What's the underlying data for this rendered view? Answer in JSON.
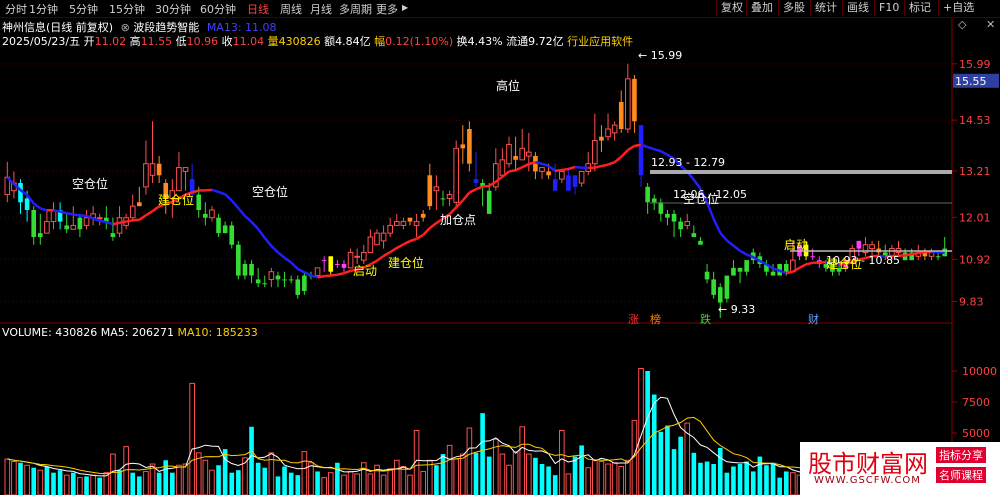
{
  "toolbar": {
    "timeframes": [
      "分时",
      "1分钟",
      "5分钟",
      "15分钟",
      "30分钟",
      "60分钟",
      "日线",
      "周线",
      "月线",
      "多周期",
      "更多"
    ],
    "active_index": 6,
    "more_arrow": "▶",
    "buttons": [
      "复权",
      "叠加",
      "多股",
      "统计",
      "画线",
      "F10",
      "标记",
      "+自选"
    ],
    "close_icon": "✕",
    "diamond_icon": "◇"
  },
  "header": {
    "stock": "神州信息(日线 前复权)",
    "indicator_icon": "⊗",
    "indicator": "波段趋势智能",
    "ma_label": "MA13: 11.08",
    "date": "2025/05/23/五",
    "open_label": "开",
    "open": "11.02",
    "high_label": "高",
    "high": "11.55",
    "low_label": "低",
    "low": "10.96",
    "close_label": "收",
    "close": "11.04",
    "vol_label": "量",
    "vol": "430826",
    "amt_label": "额",
    "amt": "4.84亿",
    "chg_label": "幅",
    "chg": "0.12(1.10%)",
    "turn_label": "换",
    "turn": "4.43%",
    "float_label": "流通",
    "float": "9.72亿",
    "industry": "行业应用软件"
  },
  "price_axis": {
    "ticks": [
      "15.99",
      "14.53",
      "13.21",
      "12.01",
      "10.92",
      "9.83"
    ],
    "current": "15.55"
  },
  "annotations": {
    "high_point": "15.99",
    "low_point": "9.33",
    "box1": "12.93 - 12.79",
    "box2": "12.06 - 12.05",
    "box3": "10.93 - 10.85",
    "labels": [
      "空仓位",
      "建仓位",
      "空仓位",
      "启动",
      "建仓位",
      "高位",
      "加仓点",
      "空仓位",
      "启动",
      "建仓位"
    ],
    "badges": [
      "涨",
      "榜",
      "跌",
      "财"
    ]
  },
  "volume": {
    "label": "VOLUME: 430826",
    "ma5": "MA5: 206271",
    "ma10": "MA10: 185233",
    "ticks": [
      "10000",
      "7500",
      "5000"
    ]
  },
  "watermark": {
    "main": "股市财富网",
    "url": "WWW.GSCFW.COM",
    "tag1": "指标分享",
    "tag2": "名师课程"
  },
  "colors": {
    "up": "#ff5050",
    "down": "#00ffff",
    "orange": "#ff8a1f",
    "green": "#33dd33",
    "ma_red": "#ff2020",
    "ma_blue": "#2020ff",
    "yellow": "#ffff00",
    "magenta": "#ff40ff"
  },
  "chart_data": {
    "type": "candlestick",
    "ylim": [
      9.4,
      16.4
    ],
    "candles": [
      [
        12.6,
        13.05,
        13.45,
        12.4,
        "up"
      ],
      [
        12.9,
        12.7,
        13.2,
        12.5,
        "up"
      ],
      [
        12.9,
        12.4,
        13.0,
        12.1,
        "down"
      ],
      [
        12.5,
        12.2,
        12.7,
        11.9,
        "down"
      ],
      [
        12.2,
        11.5,
        12.3,
        11.3,
        "green"
      ],
      [
        11.5,
        11.6,
        12.1,
        11.3,
        "green"
      ],
      [
        11.6,
        11.9,
        12.2,
        11.6,
        "up"
      ],
      [
        11.9,
        12.2,
        12.4,
        11.7,
        "up"
      ],
      [
        12.2,
        11.9,
        12.4,
        11.7,
        "down"
      ],
      [
        11.8,
        11.7,
        12.1,
        11.6,
        "green"
      ],
      [
        11.7,
        11.8,
        12.3,
        11.7,
        "up"
      ],
      [
        12.0,
        11.7,
        12.1,
        11.5,
        "green"
      ],
      [
        11.8,
        12.0,
        12.2,
        11.7,
        "up"
      ],
      [
        12.0,
        12.1,
        12.3,
        11.8,
        "up"
      ],
      [
        12.0,
        12.0,
        12.1,
        11.8,
        "up"
      ],
      [
        12.0,
        11.9,
        12.3,
        11.7,
        "green"
      ],
      [
        11.6,
        11.5,
        12.0,
        11.4,
        "green"
      ],
      [
        11.6,
        12.0,
        12.3,
        11.5,
        "up"
      ],
      [
        11.8,
        12.0,
        12.1,
        11.7,
        "up"
      ],
      [
        12.0,
        12.3,
        12.6,
        11.9,
        "up"
      ],
      [
        12.3,
        12.4,
        12.8,
        12.3,
        "orange"
      ],
      [
        12.8,
        13.4,
        14.0,
        12.6,
        "up"
      ],
      [
        13.4,
        13.1,
        14.5,
        12.9,
        "up"
      ],
      [
        13.1,
        13.4,
        13.6,
        12.9,
        "orange"
      ],
      [
        12.9,
        12.5,
        13.0,
        12.1,
        "orange"
      ],
      [
        12.5,
        12.7,
        13.0,
        12.0,
        "up"
      ],
      [
        12.7,
        13.3,
        13.7,
        12.7,
        "up"
      ],
      [
        13.2,
        13.3,
        13.3,
        12.7,
        "up"
      ],
      [
        13.0,
        12.6,
        13.4,
        12.4,
        "blue"
      ],
      [
        12.6,
        12.2,
        12.8,
        12.0,
        "green"
      ],
      [
        12.1,
        12.0,
        12.4,
        11.8,
        "green"
      ],
      [
        12.0,
        12.2,
        12.3,
        11.9,
        "up"
      ],
      [
        12.0,
        11.6,
        12.1,
        11.5,
        "green"
      ],
      [
        11.8,
        11.6,
        11.9,
        11.6,
        "green"
      ],
      [
        11.8,
        11.3,
        11.9,
        11.2,
        "green"
      ],
      [
        11.3,
        10.5,
        11.4,
        10.4,
        "green"
      ],
      [
        10.5,
        10.8,
        10.9,
        10.4,
        "green"
      ],
      [
        10.8,
        10.5,
        10.9,
        10.3,
        "green"
      ],
      [
        10.4,
        10.3,
        10.7,
        10.2,
        "green"
      ],
      [
        10.3,
        10.3,
        10.5,
        10.2,
        "green"
      ],
      [
        10.4,
        10.6,
        10.7,
        10.2,
        "up"
      ],
      [
        10.5,
        10.4,
        10.6,
        10.2,
        "green"
      ],
      [
        10.4,
        10.4,
        10.6,
        10.2,
        "green"
      ],
      [
        10.4,
        10.4,
        10.5,
        10.3,
        "green"
      ],
      [
        10.4,
        10.0,
        10.5,
        9.9,
        "green"
      ],
      [
        10.1,
        10.5,
        10.6,
        10.0,
        "green"
      ],
      [
        10.5,
        10.5,
        10.6,
        10.4,
        "green"
      ],
      [
        10.5,
        10.7,
        10.7,
        10.5,
        "up"
      ],
      [
        10.9,
        10.9,
        11.0,
        10.6,
        "magenta"
      ],
      [
        10.6,
        11.0,
        11.0,
        10.5,
        "yellow"
      ],
      [
        10.8,
        10.8,
        10.9,
        10.7,
        "magenta"
      ],
      [
        10.7,
        10.8,
        10.9,
        10.6,
        "magenta"
      ],
      [
        10.7,
        11.1,
        11.2,
        10.7,
        "up"
      ],
      [
        11.0,
        11.0,
        11.2,
        10.8,
        "up"
      ],
      [
        10.9,
        11.1,
        11.3,
        10.8,
        "up"
      ],
      [
        11.1,
        11.5,
        11.7,
        11.1,
        "up"
      ],
      [
        11.3,
        11.6,
        11.7,
        11.3,
        "up"
      ],
      [
        11.4,
        11.6,
        11.8,
        11.2,
        "up"
      ],
      [
        11.6,
        11.8,
        12.0,
        11.5,
        "up"
      ],
      [
        11.8,
        11.9,
        12.1,
        11.8,
        "up"
      ],
      [
        11.8,
        11.9,
        12.0,
        11.7,
        "up"
      ],
      [
        11.9,
        12.0,
        12.0,
        11.8,
        "orange"
      ],
      [
        11.9,
        11.8,
        12.1,
        11.5,
        "up"
      ],
      [
        12.0,
        12.1,
        12.2,
        11.9,
        "orange"
      ],
      [
        12.3,
        13.1,
        13.4,
        12.2,
        "orange"
      ],
      [
        12.7,
        12.8,
        13.1,
        12.2,
        "up"
      ],
      [
        12.5,
        12.5,
        12.7,
        12.3,
        "green"
      ],
      [
        12.5,
        12.6,
        12.7,
        12.3,
        "up"
      ],
      [
        12.4,
        13.8,
        14.0,
        12.3,
        "up"
      ],
      [
        13.8,
        13.9,
        14.4,
        13.4,
        "orange"
      ],
      [
        13.4,
        14.3,
        14.5,
        13.2,
        "orange"
      ],
      [
        13.0,
        12.9,
        13.7,
        12.8,
        "blue"
      ],
      [
        12.9,
        12.8,
        13.0,
        12.3,
        "green"
      ],
      [
        12.7,
        12.1,
        12.9,
        12.1,
        "green"
      ],
      [
        12.8,
        13.4,
        13.8,
        12.7,
        "up"
      ],
      [
        13.1,
        13.5,
        13.8,
        13.1,
        "up"
      ],
      [
        13.4,
        13.9,
        14.1,
        13.3,
        "up"
      ],
      [
        13.6,
        13.5,
        14.1,
        13.2,
        "orange"
      ],
      [
        13.5,
        13.8,
        14.3,
        13.5,
        "up"
      ],
      [
        13.7,
        13.6,
        14.2,
        13.2,
        "up"
      ],
      [
        13.6,
        13.2,
        13.7,
        13.0,
        "orange"
      ],
      [
        13.2,
        13.3,
        13.3,
        13.0,
        "up"
      ],
      [
        13.2,
        13.1,
        13.4,
        13.0,
        "orange"
      ],
      [
        13.0,
        12.7,
        13.4,
        12.7,
        "blue"
      ],
      [
        13.0,
        13.2,
        13.2,
        12.9,
        "up"
      ],
      [
        12.7,
        13.1,
        13.3,
        12.7,
        "blue"
      ],
      [
        13.1,
        12.8,
        13.1,
        12.6,
        "blue"
      ],
      [
        12.9,
        13.2,
        13.2,
        12.8,
        "up"
      ],
      [
        13.2,
        13.4,
        13.7,
        13.1,
        "up"
      ],
      [
        13.4,
        14.0,
        14.7,
        13.2,
        "up"
      ],
      [
        14.1,
        14.0,
        14.4,
        13.7,
        "orange"
      ],
      [
        14.1,
        14.3,
        14.7,
        14.0,
        "up"
      ],
      [
        14.2,
        14.4,
        14.5,
        14.0,
        "up"
      ],
      [
        14.3,
        15.0,
        15.3,
        14.2,
        "orange"
      ],
      [
        14.3,
        15.6,
        15.99,
        14.2,
        "up"
      ],
      [
        15.6,
        14.5,
        15.7,
        14.2,
        "orange"
      ],
      [
        14.4,
        13.1,
        14.4,
        12.8,
        "blue"
      ],
      [
        12.8,
        12.4,
        12.9,
        12.1,
        "green"
      ],
      [
        12.5,
        12.4,
        12.6,
        12.2,
        "green"
      ],
      [
        12.4,
        12.1,
        12.5,
        11.9,
        "green"
      ],
      [
        12.1,
        12.0,
        12.2,
        11.8,
        "green"
      ],
      [
        11.9,
        12.1,
        12.2,
        11.5,
        "green"
      ],
      [
        11.9,
        11.7,
        12.0,
        11.5,
        "green"
      ],
      [
        11.8,
        11.9,
        12.1,
        11.7,
        "up"
      ],
      [
        11.5,
        11.6,
        11.8,
        11.5,
        "green"
      ],
      [
        11.3,
        11.4,
        11.5,
        11.3,
        "green"
      ],
      [
        10.6,
        10.4,
        10.8,
        10.3,
        "green"
      ],
      [
        10.4,
        10.0,
        10.6,
        9.9,
        "green"
      ],
      [
        10.2,
        9.8,
        10.3,
        9.4,
        "green"
      ],
      [
        9.9,
        10.5,
        10.5,
        9.8,
        "green"
      ],
      [
        10.5,
        10.7,
        10.9,
        10.5,
        "green"
      ],
      [
        10.7,
        10.6,
        10.7,
        10.3,
        "green"
      ],
      [
        10.6,
        10.9,
        10.9,
        10.5,
        "green"
      ],
      [
        10.9,
        11.1,
        11.2,
        10.8,
        "green"
      ],
      [
        11.0,
        10.8,
        11.1,
        10.7,
        "green"
      ],
      [
        10.8,
        10.6,
        10.9,
        10.5,
        "green"
      ],
      [
        10.6,
        10.5,
        10.8,
        10.5,
        "green"
      ],
      [
        10.5,
        10.8,
        10.8,
        10.5,
        "green"
      ],
      [
        10.8,
        10.6,
        10.9,
        10.5,
        "green"
      ],
      [
        10.6,
        10.9,
        11.4,
        10.6,
        "up"
      ],
      [
        11.0,
        11.3,
        11.4,
        10.9,
        "magenta"
      ],
      [
        11.3,
        11.0,
        11.4,
        10.9,
        "yellow"
      ],
      [
        11.0,
        11.0,
        11.2,
        10.9,
        "magenta"
      ],
      [
        10.9,
        10.8,
        11.0,
        10.7,
        "magenta"
      ],
      [
        10.8,
        10.7,
        10.9,
        10.6,
        "green"
      ],
      [
        10.8,
        10.6,
        10.8,
        10.5,
        "green"
      ],
      [
        10.6,
        10.7,
        10.9,
        10.5,
        "green"
      ],
      [
        10.7,
        10.9,
        10.9,
        10.6,
        "magenta"
      ],
      [
        10.9,
        11.2,
        11.3,
        10.8,
        "up"
      ],
      [
        11.2,
        11.4,
        11.4,
        11.0,
        "magenta"
      ],
      [
        11.1,
        11.3,
        11.5,
        11.0,
        "up"
      ],
      [
        11.3,
        11.2,
        11.4,
        10.9,
        "up"
      ],
      [
        11.2,
        11.1,
        11.4,
        11.0,
        "orange"
      ],
      [
        11.1,
        11.0,
        11.3,
        10.9,
        "green"
      ],
      [
        11.0,
        11.2,
        11.3,
        10.9,
        "up"
      ],
      [
        11.2,
        11.1,
        11.4,
        11.0,
        "up"
      ],
      [
        11.1,
        10.9,
        11.2,
        10.9,
        "green"
      ],
      [
        10.9,
        11.1,
        11.2,
        10.9,
        "green"
      ],
      [
        11.1,
        11.0,
        11.3,
        10.9,
        "up"
      ],
      [
        11.0,
        11.1,
        11.2,
        10.9,
        "orange"
      ],
      [
        11.1,
        11.0,
        11.2,
        10.9,
        "up"
      ],
      [
        11.0,
        11.0,
        11.1,
        10.9,
        "green"
      ],
      [
        11.0,
        11.2,
        11.5,
        11.0,
        "green"
      ]
    ],
    "ma13_up_color": "red",
    "volume_values": [
      2.9,
      2.7,
      2.6,
      2.4,
      2.2,
      2.0,
      2.3,
      1.8,
      2.0,
      1.6,
      1.8,
      1.4,
      1.5,
      1.6,
      1.4,
      1.8,
      3.3,
      2.0,
      3.9,
      1.8,
      1.5,
      1.9,
      2.5,
      1.8,
      2.8,
      1.8,
      2.4,
      2.5,
      9.0,
      3.4,
      2.8,
      2.0,
      2.4,
      3.7,
      1.8,
      2.0,
      3.0,
      5.5,
      2.6,
      2.2,
      3.4,
      1.5,
      2.3,
      1.8,
      1.6,
      3.5,
      2.6,
      1.9,
      1.4,
      1.8,
      2.6,
      1.6,
      1.9,
      1.7,
      2.6,
      1.7,
      2.4,
      1.6,
      2.1,
      2.8,
      2.3,
      1.6,
      5.2,
      1.9,
      2.8,
      2.4,
      3.3,
      4.0,
      2.9,
      3.3,
      5.4,
      3.4,
      6.6,
      3.1,
      4.5,
      3.3,
      2.4,
      3.5,
      5.5,
      3.3,
      3.0,
      2.5,
      2.3,
      1.6,
      5.2,
      1.7,
      3.1,
      4.0,
      2.2,
      2.8,
      2.7,
      2.5,
      2.6,
      2.3,
      2.8,
      6.0,
      10.2,
      10.0,
      8.1,
      5.1,
      5.6,
      3.7,
      4.7,
      5.8,
      3.4,
      2.6,
      2.7,
      2.5,
      3.8,
      1.8,
      2.3,
      2.5,
      2.7,
      1.9,
      3.1,
      2.4,
      2.6,
      1.4,
      1.9,
      1.8,
      1.6,
      1.8,
      1.3,
      2.1,
      2.6,
      2.2,
      3.5,
      2.4,
      2.1,
      1.8,
      2.4,
      2.5,
      2.8,
      1.7,
      3.3,
      2.5,
      1.7,
      1.9,
      1.4,
      1.2,
      0.9,
      1.4,
      1.8,
      1.6,
      1.4,
      1.7
    ],
    "volume_colors": [
      "up",
      "up",
      "down",
      "up",
      "down",
      "up",
      "down",
      "down",
      "down",
      "up",
      "down",
      "up",
      "down",
      "up",
      "down",
      "up",
      "up",
      "down",
      "up",
      "down",
      "down",
      "up",
      "up",
      "down",
      "down",
      "down",
      "up",
      "up",
      "up",
      "up",
      "up",
      "up",
      "down",
      "down",
      "down",
      "down",
      "up",
      "down",
      "down",
      "down",
      "up",
      "down",
      "down",
      "down",
      "down",
      "up",
      "up",
      "down",
      "up",
      "up",
      "down",
      "up",
      "up",
      "up",
      "up",
      "up",
      "up",
      "up",
      "up",
      "up",
      "up",
      "up",
      "up",
      "up",
      "up",
      "down",
      "down",
      "up",
      "up",
      "up",
      "up",
      "down",
      "down",
      "down",
      "up",
      "up",
      "up",
      "up",
      "up",
      "up",
      "down",
      "down",
      "down",
      "down",
      "up",
      "up",
      "down",
      "down",
      "up",
      "up",
      "up",
      "up",
      "up",
      "up",
      "up",
      "up",
      "up",
      "down",
      "down",
      "down",
      "down",
      "down",
      "down",
      "up",
      "down",
      "down",
      "down",
      "down",
      "down",
      "down",
      "down",
      "down",
      "down",
      "down",
      "down",
      "down",
      "down",
      "down",
      "down",
      "up",
      "up",
      "down",
      "down",
      "down",
      "down",
      "down",
      "down",
      "up",
      "up",
      "down",
      "up",
      "down",
      "down",
      "down",
      "up",
      "up",
      "down",
      "down",
      "up",
      "up",
      "down",
      "down",
      "down",
      "down",
      "down",
      "down"
    ],
    "volume_ylim": [
      0,
      12500
    ]
  }
}
